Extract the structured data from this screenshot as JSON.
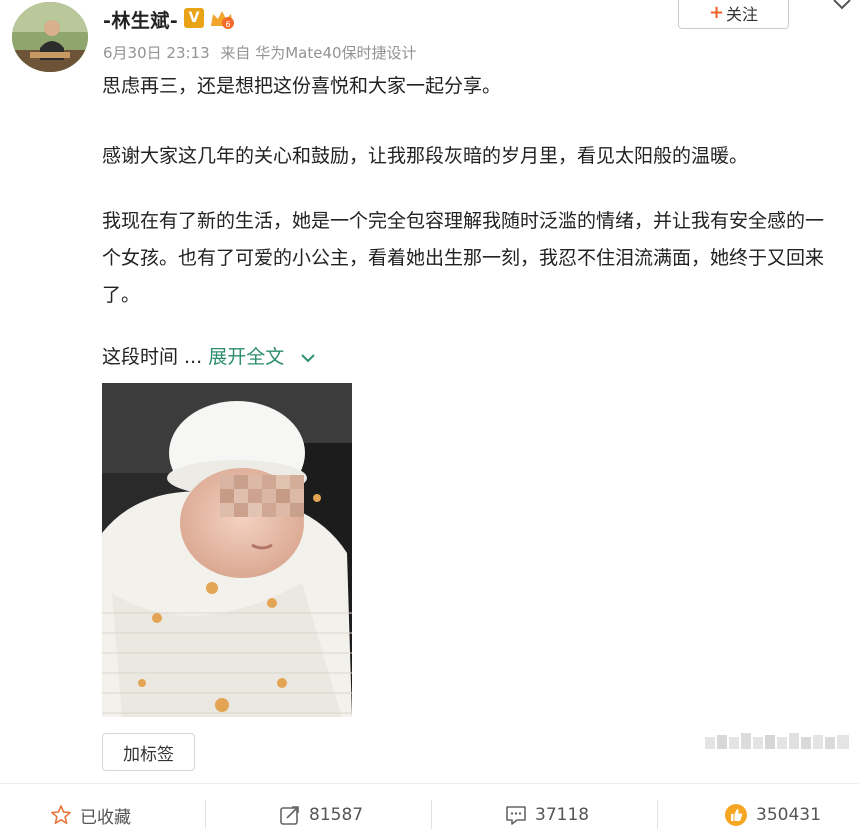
{
  "post": {
    "author": {
      "name": "-林生斌-",
      "badge_v": "V",
      "avatar": "avatar-photo"
    },
    "meta": {
      "time": "6月30日 23:13",
      "source_prefix": "来自",
      "source": "华为Mate40保时捷设计"
    },
    "follow_label": "关注",
    "paragraphs": [
      "思虑再三，还是想把这份喜悦和大家一起分享。",
      "感谢大家这几年的关心和鼓励，让我那段灰暗的岁月里，看见太阳般的温暖。",
      "我现在有了新的生活，她是一个完全包容理解我随时泛滥的情绪，并让我有安全感的一个女孩。也有了可爱的小公主，看着她出生那一刻，我忍不住泪流满面，她终于又回来了。"
    ],
    "truncated_text": "这段时间 ...",
    "expand_label": "展开全文",
    "image": "newborn-baby-photo",
    "tag_button_label": "加标签"
  },
  "actions": {
    "favorite": {
      "label": "已收藏",
      "icon": "star-icon"
    },
    "share": {
      "count": "81587",
      "icon": "share-icon"
    },
    "comment": {
      "count": "37118",
      "icon": "comment-icon"
    },
    "like": {
      "count": "350431",
      "icon": "thumbs-up-icon"
    }
  },
  "colors": {
    "expand_link": "#2d8e6e",
    "follow_plus": "#f0642d",
    "meta_text": "#939393",
    "like_icon": "#f5a623"
  }
}
